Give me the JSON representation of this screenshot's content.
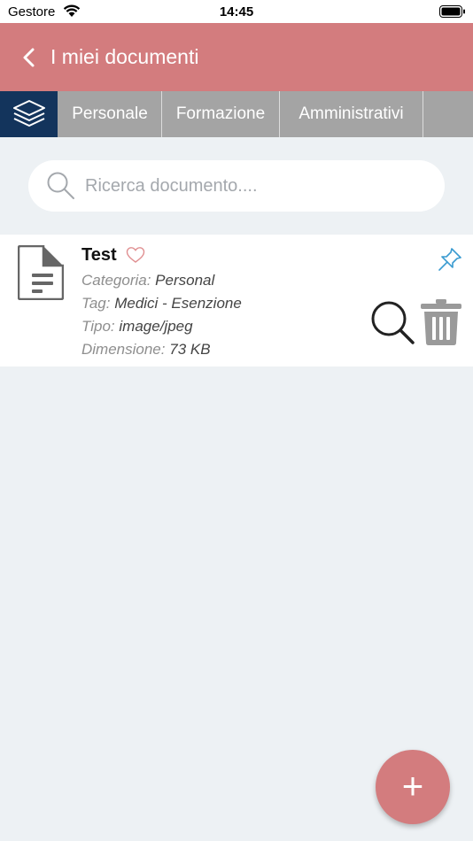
{
  "status_bar": {
    "carrier": "Gestore",
    "time": "14:45"
  },
  "header": {
    "title": "I miei documenti",
    "back_icon": "chevron-left-icon"
  },
  "tabs": [
    {
      "label": "Personale"
    },
    {
      "label": "Formazione"
    },
    {
      "label": "Amministrativi"
    }
  ],
  "search": {
    "placeholder": "Ricerca documento...."
  },
  "documents": [
    {
      "title": "Test",
      "category_label": "Categoria:",
      "category": "Personal",
      "tag_label": "Tag:",
      "tag": "Medici - Esenzione",
      "type_label": "Tipo:",
      "type": "image/jpeg",
      "size_label": "Dimensione:",
      "size": "73 KB"
    }
  ],
  "fab": {
    "label": "+"
  },
  "colors": {
    "header": "#d37c7e",
    "active_tab": "#13345c",
    "tab_bar": "#a4a4a4",
    "background": "#edf1f4",
    "pin": "#3a9bd0"
  }
}
